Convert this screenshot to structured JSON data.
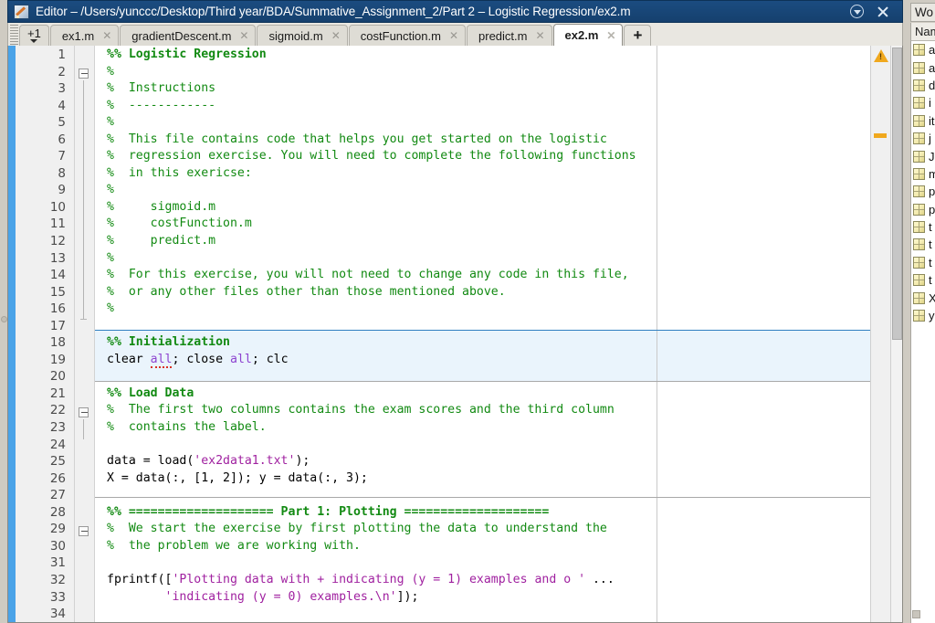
{
  "window": {
    "title": "Editor – /Users/yunccc/Desktop/Third year/BDA/Summative_Assignment_2/Part 2 – Logistic Regression/ex2.m",
    "icon": "editor-pencil-icon",
    "dropdown_label": "▼",
    "close_label": "×"
  },
  "tabs": {
    "overflow_label": "+1",
    "new_tab_label": "+",
    "close_glyph": "✕",
    "items": [
      {
        "label": "ex1.m",
        "active": false
      },
      {
        "label": "gradientDescent.m",
        "active": false
      },
      {
        "label": "sigmoid.m",
        "active": false
      },
      {
        "label": "costFunction.m",
        "active": false
      },
      {
        "label": "predict.m",
        "active": false
      },
      {
        "label": "ex2.m",
        "active": true
      }
    ]
  },
  "editor": {
    "first_line": 1,
    "last_line": 34,
    "line_numbers": [
      1,
      2,
      3,
      4,
      5,
      6,
      7,
      8,
      9,
      10,
      11,
      12,
      13,
      14,
      15,
      16,
      17,
      18,
      19,
      20,
      21,
      22,
      23,
      24,
      25,
      26,
      27,
      28,
      29,
      30,
      31,
      32,
      33,
      34
    ],
    "lines": [
      {
        "n": 1,
        "html": "<span class=\"cmb\">%% Logistic Regression</span>"
      },
      {
        "n": 2,
        "html": "<span class=\"cm\">%</span>"
      },
      {
        "n": 3,
        "html": "<span class=\"cm\">%  Instructions</span>"
      },
      {
        "n": 4,
        "html": "<span class=\"cm\">%  ------------</span>"
      },
      {
        "n": 5,
        "html": "<span class=\"cm\">%</span>"
      },
      {
        "n": 6,
        "html": "<span class=\"cm\">%  This file contains code that helps you get started on the logistic</span>"
      },
      {
        "n": 7,
        "html": "<span class=\"cm\">%  regression exercise. You will need to complete the following functions</span>"
      },
      {
        "n": 8,
        "html": "<span class=\"cm\">%  in this exericse:</span>"
      },
      {
        "n": 9,
        "html": "<span class=\"cm\">%</span>"
      },
      {
        "n": 10,
        "html": "<span class=\"cm\">%     sigmoid.m</span>"
      },
      {
        "n": 11,
        "html": "<span class=\"cm\">%     costFunction.m</span>"
      },
      {
        "n": 12,
        "html": "<span class=\"cm\">%     predict.m</span>"
      },
      {
        "n": 13,
        "html": "<span class=\"cm\">%</span>"
      },
      {
        "n": 14,
        "html": "<span class=\"cm\">%  For this exercise, you will not need to change any code in this file,</span>"
      },
      {
        "n": 15,
        "html": "<span class=\"cm\">%  or any other files other than those mentioned above.</span>"
      },
      {
        "n": 16,
        "html": "<span class=\"cm\">%</span>"
      },
      {
        "n": 17,
        "html": ""
      },
      {
        "n": 18,
        "html": "<span class=\"cmb\">%% Initialization</span>"
      },
      {
        "n": 19,
        "html": "clear <span class=\"kw sq\">all</span>; close <span class=\"kw\">all</span>; clc"
      },
      {
        "n": 20,
        "html": ""
      },
      {
        "n": 21,
        "html": "<span class=\"cmb\">%% Load Data</span>"
      },
      {
        "n": 22,
        "html": "<span class=\"cm\">%  The first two columns contains the exam scores and the third column</span>"
      },
      {
        "n": 23,
        "html": "<span class=\"cm\">%  contains the label.</span>"
      },
      {
        "n": 24,
        "html": ""
      },
      {
        "n": 25,
        "html": "data = load(<span class=\"str\">'ex2data1.txt'</span>);"
      },
      {
        "n": 26,
        "html": "X = data(:, [1, 2]); y = data(:, 3);"
      },
      {
        "n": 27,
        "html": ""
      },
      {
        "n": 28,
        "html": "<span class=\"cmb\">%% ==================== Part 1: Plotting ====================</span>"
      },
      {
        "n": 29,
        "html": "<span class=\"cm\">%  We start the exercise by first plotting the data to understand the</span>"
      },
      {
        "n": 30,
        "html": "<span class=\"cm\">%  the problem we are working with.</span>"
      },
      {
        "n": 31,
        "html": ""
      },
      {
        "n": 32,
        "html": "fprintf([<span class=\"str\">'Plotting data with + indicating (y = 1) examples and o '</span> ...</span>"
      },
      {
        "n": 33,
        "html": "        <span class=\"str\">'indicating (y = 0) examples.\\n'</span>]);"
      },
      {
        "n": 34,
        "html": ""
      }
    ],
    "plain_text": [
      "%% Logistic Regression",
      "%",
      "%  Instructions",
      "%  ------------",
      "%",
      "%  This file contains code that helps you get started on the logistic",
      "%  regression exercise. You will need to complete the following functions",
      "%  in this exericse:",
      "%",
      "%     sigmoid.m",
      "%     costFunction.m",
      "%     predict.m",
      "%",
      "%  For this exercise, you will not need to change any code in this file,",
      "%  or any other files other than those mentioned above.",
      "%",
      "",
      "%% Initialization",
      "clear all; close all; clc",
      "",
      "%% Load Data",
      "%  The first two columns contains the exam scores and the third column",
      "%  contains the label.",
      "",
      "data = load('ex2data1.txt');",
      "X = data(:, [1, 2]); y = data(:, 3);",
      "",
      "%% ==================== Part 1: Plotting ====================",
      "%  We start the exercise by first plotting the data to understand the",
      "%  the problem we are working with.",
      "",
      "fprintf(['Plotting data with + indicating (y = 1) examples and o ' ...",
      "        'indicating (y = 0) examples.\\n']);",
      ""
    ],
    "analyzer": {
      "warning_icon": "warning-triangle-icon",
      "warning_mark": "code-warning-marker"
    }
  },
  "workspace": {
    "panel_title": "Wo",
    "column_header": "Nam",
    "variables": [
      {
        "name": "a"
      },
      {
        "name": "a"
      },
      {
        "name": "d"
      },
      {
        "name": "i"
      },
      {
        "name": "it"
      },
      {
        "name": "j"
      },
      {
        "name": "J."
      },
      {
        "name": "m"
      },
      {
        "name": "p"
      },
      {
        "name": "p"
      },
      {
        "name": "t"
      },
      {
        "name": "t"
      },
      {
        "name": "t"
      },
      {
        "name": "t"
      },
      {
        "name": "X"
      },
      {
        "name": "y"
      }
    ]
  },
  "colors": {
    "titlebar": "#1b4c80",
    "comment": "#128a12",
    "string": "#a021a0",
    "keyword": "#8e44d0",
    "modified_strip": "#4aa3e8",
    "section_divider_active": "#2f7fc1",
    "warning": "#f0a81e"
  }
}
